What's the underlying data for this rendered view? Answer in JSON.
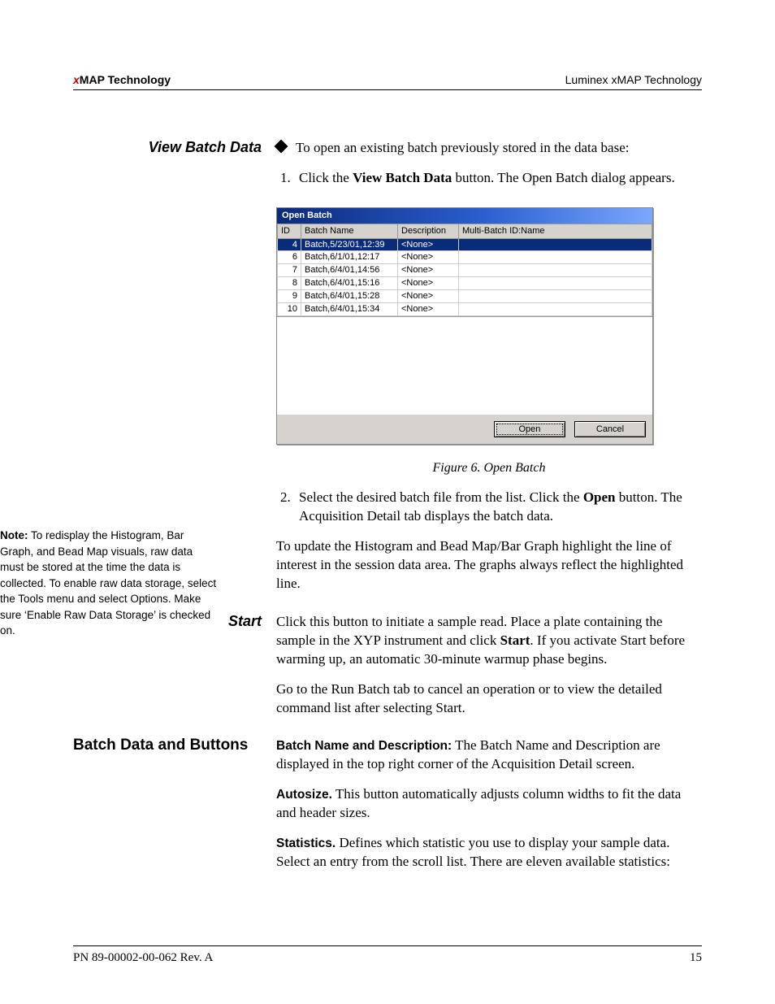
{
  "header": {
    "left_prefix": "x",
    "left_rest": "MAP Technology",
    "right": "Luminex xMAP Technology"
  },
  "section_view_batch": {
    "title": "View Batch Data",
    "intro": "To open an existing batch previously stored in the data base:",
    "steps": {
      "s1_a": "Click the ",
      "s1_b": "View Batch Data",
      "s1_c": " button. The Open Batch dialog appears.",
      "s2_a": "Select the desired batch file from the list. Click the ",
      "s2_b": "Open",
      "s2_c": " button. The Acquisition Detail tab displays the batch data."
    },
    "post": "To update the Histogram and Bead Map/Bar Graph highlight the line of interest in the session data area. The graphs always reflect the highlighted line."
  },
  "dialog": {
    "title": "Open Batch",
    "cols": {
      "id": "ID",
      "name": "Batch Name",
      "desc": "Description",
      "multi": "Multi-Batch ID:Name"
    },
    "rows": [
      {
        "id": "4",
        "name": "Batch,5/23/01,12:39",
        "desc": "<None>",
        "multi": "",
        "sel": true
      },
      {
        "id": "6",
        "name": "Batch,6/1/01,12:17",
        "desc": "<None>",
        "multi": ""
      },
      {
        "id": "7",
        "name": "Batch,6/4/01,14:56",
        "desc": "<None>",
        "multi": ""
      },
      {
        "id": "8",
        "name": "Batch,6/4/01,15:16",
        "desc": "<None>",
        "multi": ""
      },
      {
        "id": "9",
        "name": "Batch,6/4/01,15:28",
        "desc": "<None>",
        "multi": ""
      },
      {
        "id": "10",
        "name": "Batch,6/4/01,15:34",
        "desc": "<None>",
        "multi": ""
      }
    ],
    "open": "Open",
    "cancel": "Cancel"
  },
  "figure_caption": "Figure 6.  Open Batch",
  "note": {
    "label": "Note:",
    "text": " To redisplay the Histogram, Bar Graph, and Bead Map visuals, raw data must be stored at the time the data is collected. To enable raw data storage, select the Tools menu and select Options. Make sure ‘Enable Raw Data Storage’ is checked on."
  },
  "section_start": {
    "title": "Start",
    "p1a": "Click this button to initiate a sample read. Place a plate containing the sample in the XYP instrument and click ",
    "p1b": "Start",
    "p1c": ". If you activate Start before warming up, an automatic 30-minute warmup phase begins.",
    "p2": "Go to the Run Batch tab to cancel an operation or to view the detailed command list after selecting Start."
  },
  "section_batchdata": {
    "title": "Batch Data and Buttons",
    "bn_label": "Batch Name and Description:",
    "bn_text": " The Batch Name and Description are displayed in the top right corner of the Acquisition Detail screen.",
    "auto_label": "Autosize.",
    "auto_text": "  This button automatically adjusts column widths to fit the data and header sizes.",
    "stat_label": "Statistics.",
    "stat_text": " Defines which statistic you use to display your sample data. Select an entry from the scroll list. There are eleven available statistics:"
  },
  "footer": {
    "left": "PN 89-00002-00-062 Rev. A",
    "right": "15"
  }
}
